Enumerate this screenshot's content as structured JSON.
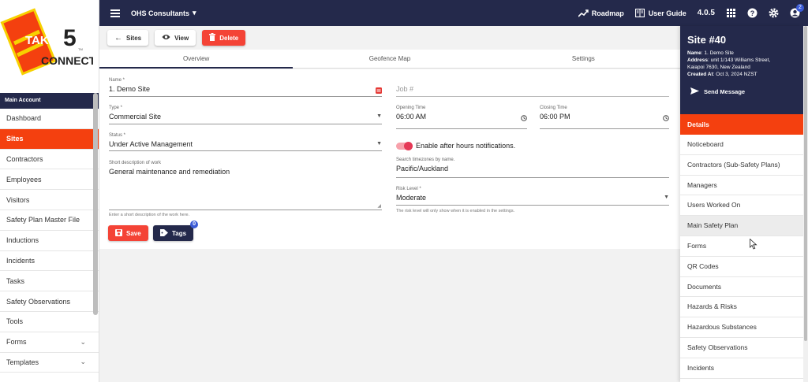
{
  "brand": {
    "logo_text_1": "TAKE",
    "logo_text_2": "5",
    "logo_text_3": "CONNECT",
    "logo_tm": "TM",
    "orange": "#f4400f",
    "navy": "#24294b"
  },
  "topbar": {
    "org": "OHS Consultants",
    "roadmap": "Roadmap",
    "user_guide": "User Guide",
    "version": "4.0.5",
    "notif_count": "2"
  },
  "sidebar": {
    "section": "Main Account",
    "items": [
      {
        "label": "Dashboard"
      },
      {
        "label": "Sites",
        "active": true
      },
      {
        "label": "Contractors"
      },
      {
        "label": "Employees"
      },
      {
        "label": "Visitors"
      },
      {
        "label": "Safety Plan Master File"
      },
      {
        "label": "Inductions"
      },
      {
        "label": "Incidents"
      },
      {
        "label": "Tasks"
      },
      {
        "label": "Safety Observations"
      },
      {
        "label": "Tools"
      },
      {
        "label": "Forms",
        "expandable": true
      },
      {
        "label": "Templates",
        "expandable": true
      }
    ]
  },
  "toolbar": {
    "back_label": "Sites",
    "view_label": "View",
    "delete_label": "Delete"
  },
  "tabs": [
    {
      "label": "Overview"
    },
    {
      "label": "Geofence Map"
    },
    {
      "label": "Settings"
    }
  ],
  "form": {
    "name_label": "Name *",
    "name_value": "1. Demo Site",
    "type_label": "Type *",
    "type_value": "Commercial Site",
    "status_label": "Status *",
    "status_value": "Under Active Management",
    "desc_label": "Short description of work",
    "desc_value": "General maintenance and remediation",
    "desc_hint": "Enter a short description of the work here.",
    "job_placeholder": "Job #",
    "opening_label": "Opening Time",
    "opening_value": "06:00 AM",
    "closing_label": "Closing Time",
    "closing_value": "06:00 PM",
    "toggle_label": "Enable after hours notifications.",
    "tz_label": "Search timezones by name.",
    "tz_value": "Pacific/Auckland",
    "risk_label": "Risk Level *",
    "risk_value": "Moderate",
    "risk_hint": "The risk level will only show when it is enabled in the settings.",
    "save_label": "Save",
    "tags_label": "Tags",
    "tags_count": "0"
  },
  "panel": {
    "title": "Site #40",
    "name_key": "Name",
    "name_val": "1. Demo Site",
    "address_key": "Address",
    "address_val": "unit 1/143 Williams Street,",
    "address_val2": "Kaiapoi 7630, New Zealand",
    "created_key": "Created At",
    "created_val": "Oct 3, 2024 NZST",
    "send_message": "Send Message",
    "details_header": "Details",
    "items": [
      {
        "label": "Noticeboard"
      },
      {
        "label": "Contractors (Sub-Safety Plans)"
      },
      {
        "label": "Managers"
      },
      {
        "label": "Users Worked On"
      },
      {
        "label": "Main Safety Plan",
        "hover": true
      },
      {
        "label": "Forms"
      },
      {
        "label": "QR Codes"
      },
      {
        "label": "Documents"
      },
      {
        "label": "Hazards & Risks"
      },
      {
        "label": "Hazardous Substances"
      },
      {
        "label": "Safety Observations"
      },
      {
        "label": "Incidents"
      }
    ]
  }
}
